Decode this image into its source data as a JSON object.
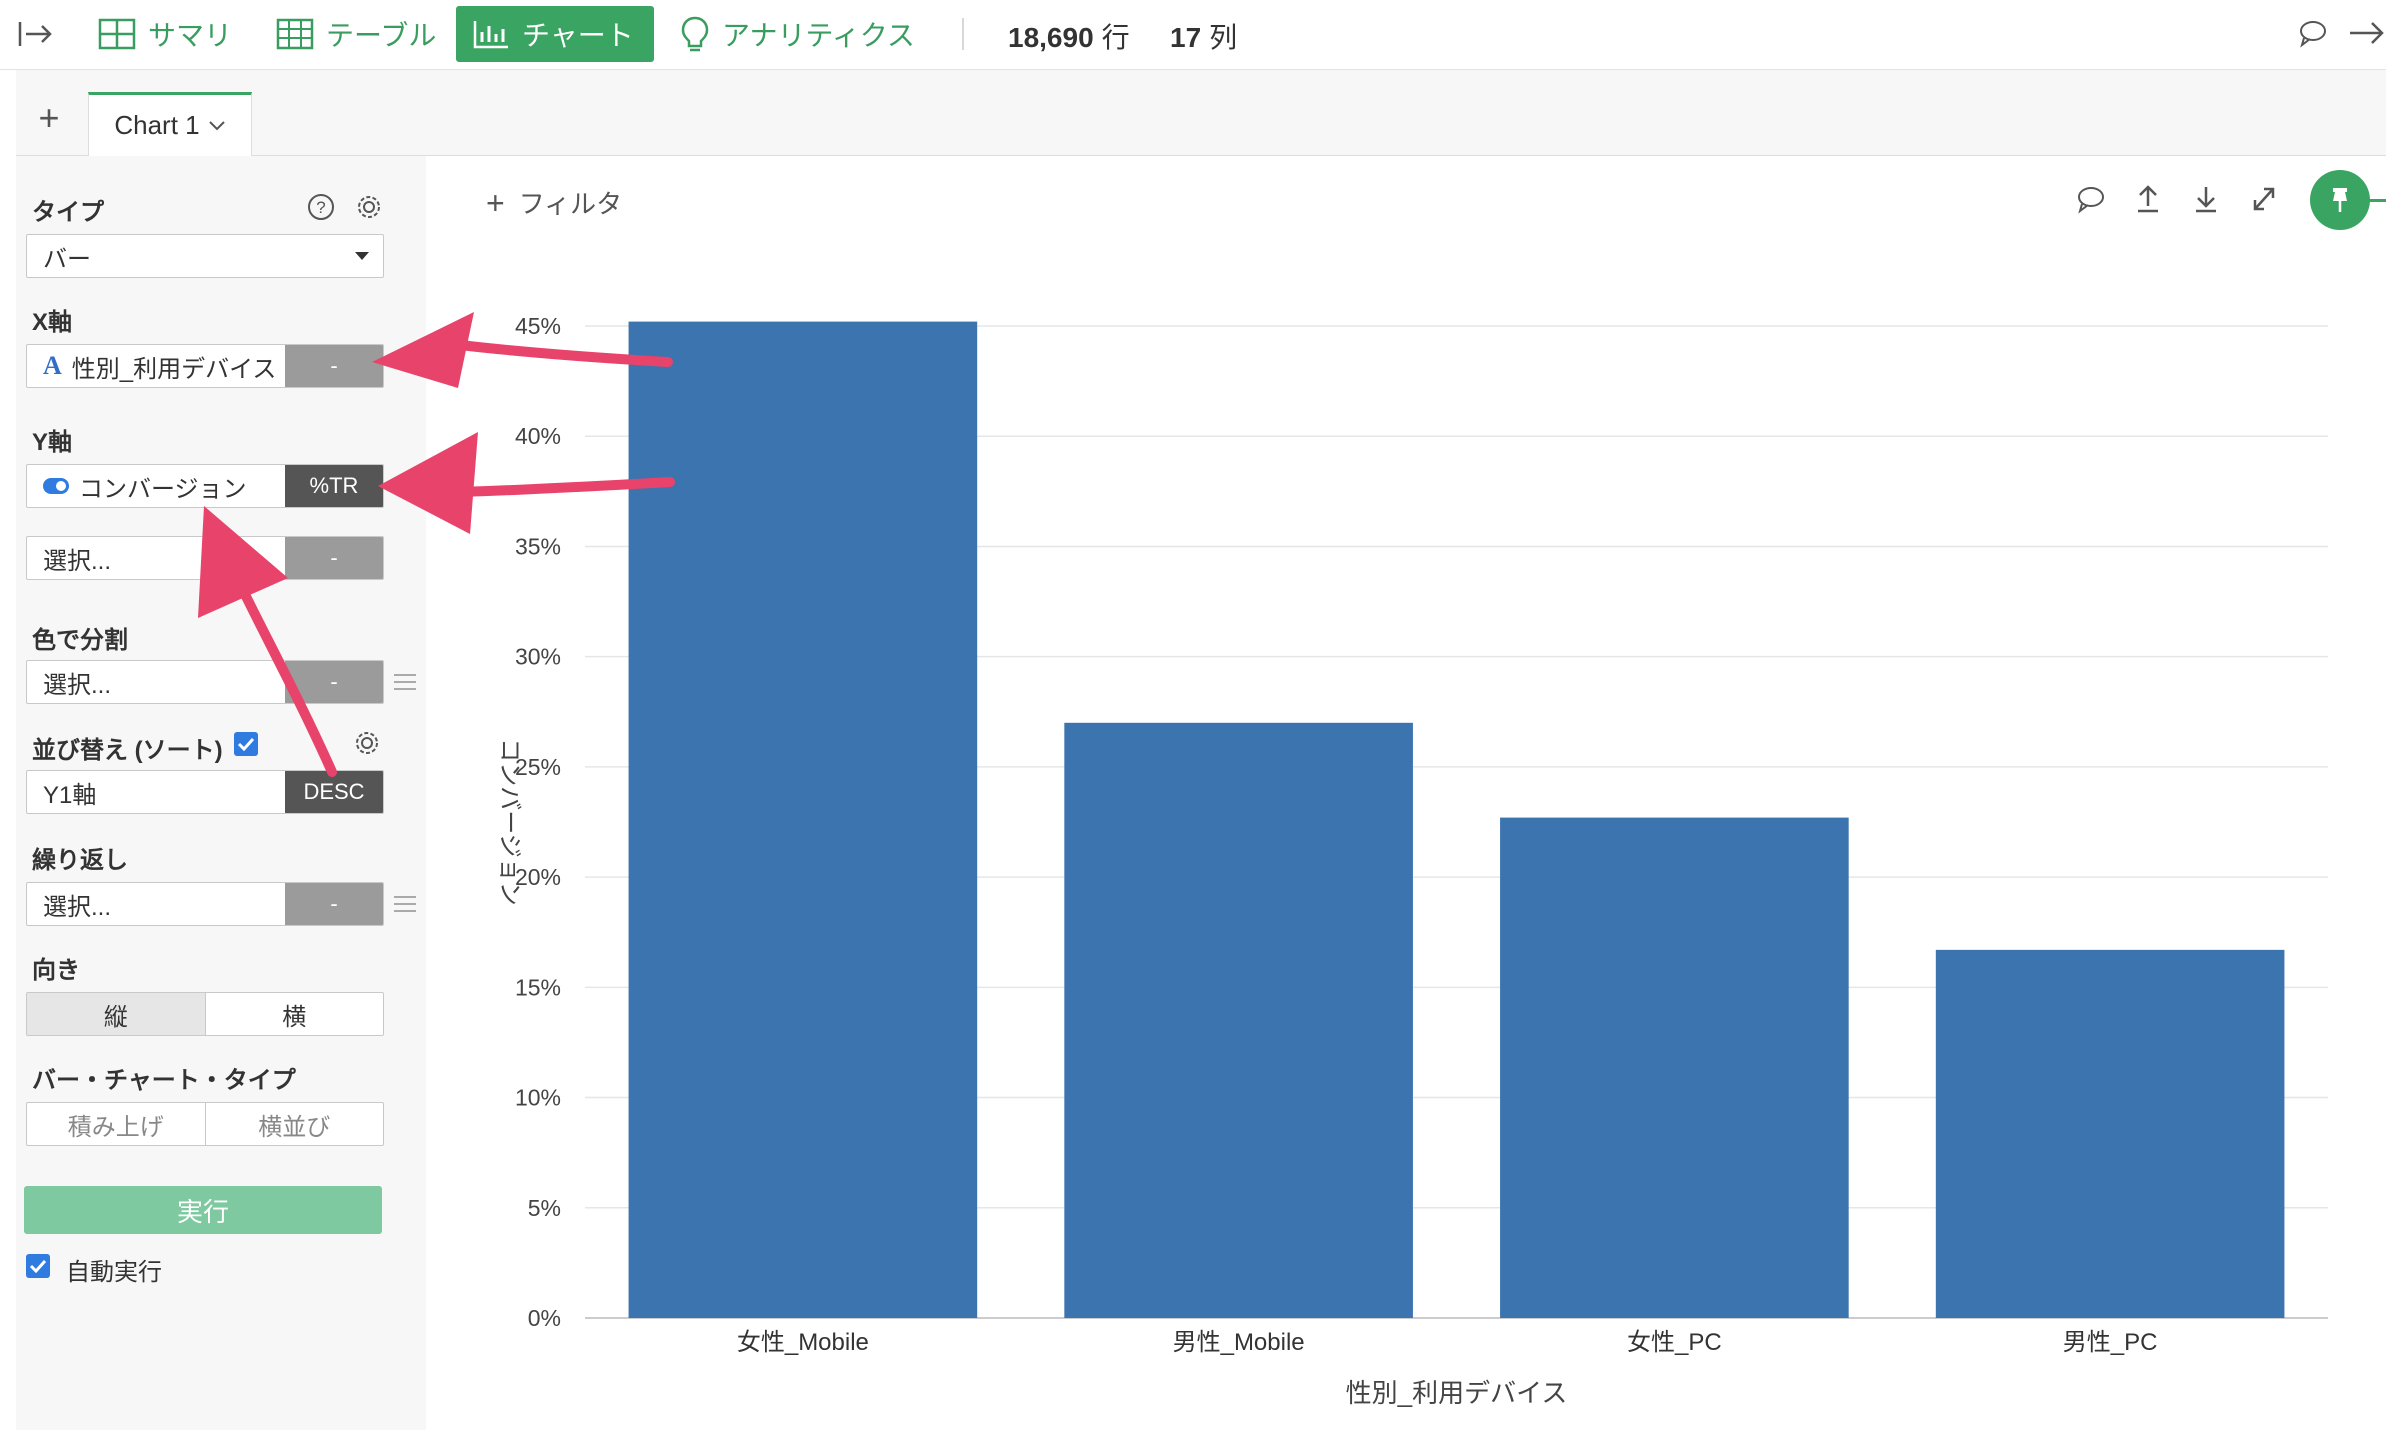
{
  "toolbar": {
    "items": [
      {
        "label": "サマリ",
        "icon": "grid-icon"
      },
      {
        "label": "テーブル",
        "icon": "table-icon"
      },
      {
        "label": "チャート",
        "icon": "bar-chart-icon",
        "active": true
      },
      {
        "label": "アナリティクス",
        "icon": "lightbulb-icon"
      }
    ],
    "rows": "18,690",
    "rows_unit": "行",
    "cols": "17",
    "cols_unit": "列"
  },
  "tabs": {
    "add": "+",
    "current": "Chart 1"
  },
  "panel": {
    "type_label": "タイプ",
    "type_value": "バー",
    "x_label": "X軸",
    "x_value": "性別_利用デバイス",
    "x_tag": "-",
    "y_label": "Y軸",
    "y_value": "コンバージョン",
    "y_tag": "%TR",
    "y2_placeholder": "選択...",
    "y2_tag": "-",
    "color_label": "色で分割",
    "color_placeholder": "選択...",
    "color_tag": "-",
    "sort_label": "並び替え (ソート)",
    "sort_value": "Y1軸",
    "sort_tag": "DESC",
    "repeat_label": "繰り返し",
    "repeat_placeholder": "選択...",
    "repeat_tag": "-",
    "orient_label": "向き",
    "orient_options": [
      "縦",
      "横"
    ],
    "bartype_label": "バー・チャート・タイプ",
    "bartype_options": [
      "積み上げ",
      "横並び"
    ],
    "run": "実行",
    "auto_run": "自動実行"
  },
  "filter_label": "フィルタ",
  "colors": {
    "accent": "#3aa562",
    "bar": "#3b74ae",
    "arrow": "#e8436b"
  },
  "chart_data": {
    "type": "bar",
    "categories": [
      "女性_Mobile",
      "男性_Mobile",
      "女性_PC",
      "男性_PC"
    ],
    "values": [
      45.2,
      27.0,
      22.7,
      16.7
    ],
    "xlabel": "性別_利用デバイス",
    "ylabel": "コンバージョン",
    "ylim": [
      0,
      45
    ],
    "yticks": [
      "0%",
      "5%",
      "10%",
      "15%",
      "20%",
      "25%",
      "30%",
      "35%",
      "40%",
      "45%"
    ],
    "grid": true
  }
}
